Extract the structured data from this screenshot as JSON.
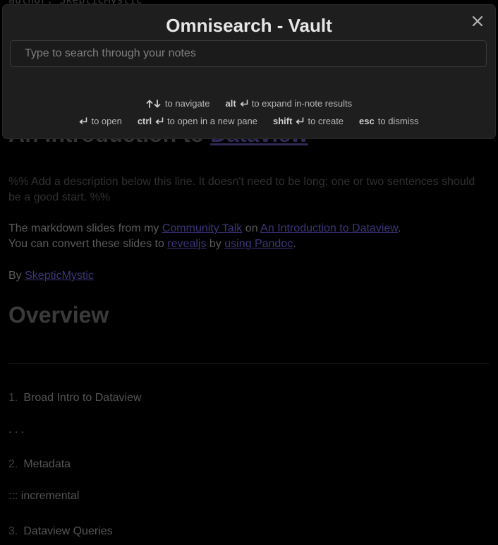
{
  "note": {
    "frontmatter_line": "author: SkepticMystic",
    "title_prefix": "An Introduction to ",
    "title_link": "Dataview",
    "comment": "%% Add a description below this line. It doesn't need to be long: one or two sentences should be a good start. %%",
    "para1": {
      "t1": "The markdown slides from my ",
      "link1": "Community Talk",
      "t2": " on ",
      "link2": "An Introduction to Dataview",
      "t3": "."
    },
    "para2": {
      "t1": "You can convert these slides to ",
      "link1": "revealjs",
      "t2": " by ",
      "link2": "using Pandoc",
      "t3": "."
    },
    "byline": {
      "t1": "By ",
      "link": "SkepticMystic"
    },
    "overview_heading": "Overview",
    "item1_num": "1.",
    "item1": "Broad Intro to Dataview",
    "ellipsis": ". . .",
    "item2_num": "2.",
    "item2": "Metadata",
    "incremental": "::: incremental",
    "item3_num": "3.",
    "item3": "Dataview Queries"
  },
  "modal": {
    "title": "Omnisearch - Vault",
    "search_placeholder": "Type to search through your notes",
    "search_value": "",
    "hints": {
      "navigate": "to navigate",
      "alt_key": "alt",
      "expand": "to expand in-note results",
      "open": "to open",
      "ctrl_key": "ctrl",
      "open_new_pane": "to open in a new pane",
      "shift_key": "shift",
      "create": "to create",
      "esc_key": "esc",
      "dismiss": "to dismiss"
    }
  },
  "icons": {
    "close": "close-icon",
    "navigate": "up-down-arrows-icon",
    "enter": "enter-icon"
  },
  "colors": {
    "modal_bg": "#1e1e1e",
    "page_bg": "#000000",
    "link_dim": "#3b3579"
  }
}
